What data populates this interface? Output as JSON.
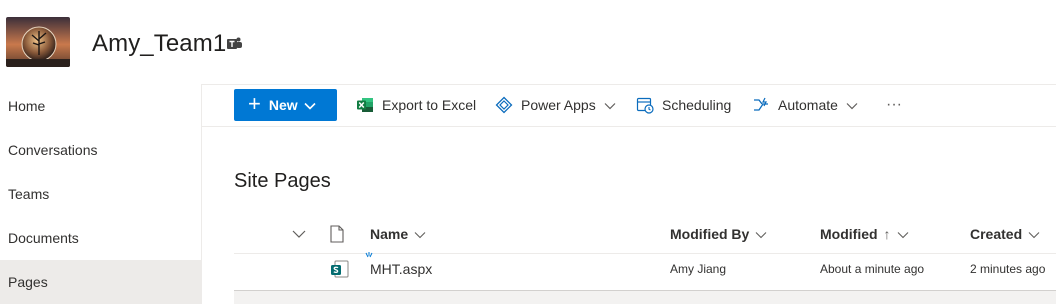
{
  "site": {
    "title": "Amy_Team1",
    "teams_icon": "teams-icon",
    "logo_icon": "site-logo-image"
  },
  "nav": {
    "items": [
      {
        "label": "Home",
        "active": false
      },
      {
        "label": "Conversations",
        "active": false
      },
      {
        "label": "Teams",
        "active": false
      },
      {
        "label": "Documents",
        "active": false
      },
      {
        "label": "Pages",
        "active": true
      }
    ]
  },
  "toolbar": {
    "new_label": "New",
    "export_label": "Export to Excel",
    "powerapps_label": "Power Apps",
    "scheduling_label": "Scheduling",
    "automate_label": "Automate",
    "more_label": "···"
  },
  "main": {
    "title": "Site Pages",
    "columns": {
      "name": "Name",
      "modified_by": "Modified By",
      "modified": "Modified",
      "created": "Created",
      "sort_indicator": "↑"
    },
    "rows": [
      {
        "name": "MHT.aspx",
        "modified_by": "Amy Jiang",
        "modified": "About a minute ago",
        "created": "2 minutes ago"
      }
    ]
  },
  "colors": {
    "accent": "#0078d4",
    "excel_green": "#107c41",
    "powerapps_blue": "#0b6cbd",
    "nav_active_bg": "#edebe9"
  }
}
